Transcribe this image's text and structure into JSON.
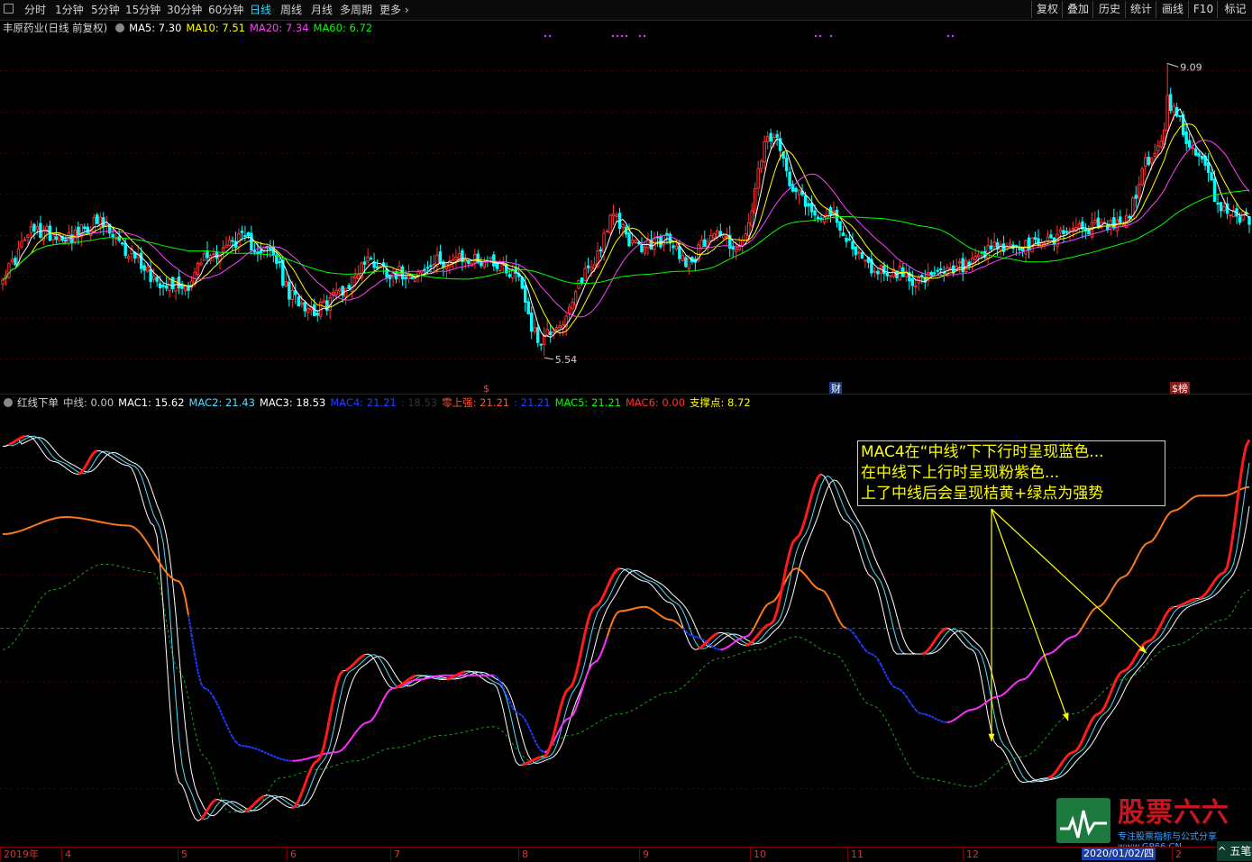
{
  "toolbar": {
    "tabs": [
      "分时",
      "1分钟",
      "5分钟",
      "15分钟",
      "30分钟",
      "60分钟",
      "日线",
      "周线",
      "月线",
      "多周期",
      "更多"
    ],
    "active_tab": "日线",
    "right_buttons": [
      "复权",
      "叠加",
      "历史",
      "统计",
      "画线",
      "F10",
      "标记"
    ]
  },
  "price_panel": {
    "stock_name": "丰原药业(日线 前复权)",
    "legend": [
      {
        "label": "MA5: 7.30",
        "color": "#ffffff"
      },
      {
        "label": "MA10: 7.51",
        "color": "#ffff00"
      },
      {
        "label": "MA20: 7.34",
        "color": "#ff40ff"
      },
      {
        "label": "MA60: 6.72",
        "color": "#00ff00"
      }
    ],
    "high_label": "9.09",
    "low_label": "5.54",
    "event_markers": [
      "$",
      "财",
      "$榜"
    ]
  },
  "indicator_panel": {
    "name": "红线下单",
    "legend": [
      {
        "label": "中线: 0.00",
        "color": "#c8c8c8"
      },
      {
        "label": "MAC1: 15.62",
        "color": "#ffffff"
      },
      {
        "label": "MAC2: 21.43",
        "color": "#50e0ff"
      },
      {
        "label": "MAC3: 18.53",
        "color": "#ffffff"
      },
      {
        "label": "MAC4: 21.21",
        "color": "#2040ff"
      },
      {
        "label": ": 18.53",
        "color": "#333333"
      },
      {
        "label": "零上强: 21.21",
        "color": "#ff5030"
      },
      {
        "label": ": 21.21",
        "color": "#2040ff"
      },
      {
        "label": "MAC5: 21.21",
        "color": "#00ff00"
      },
      {
        "label": "MAC6: 0.00",
        "color": "#ff3030"
      },
      {
        "label": "支撑点: 8.72",
        "color": "#ffff00"
      }
    ],
    "annotation_lines": [
      "MAC4在“中线”下下行时呈现蓝色...",
      "在中线下上行时呈现粉紫色...",
      "上了中线后会呈现桔黄+绿点为强势"
    ]
  },
  "x_axis_labels": [
    "2019年",
    "4",
    "5",
    "6",
    "7",
    "8",
    "9",
    "10",
    "11",
    "12",
    "2"
  ],
  "cursor_date": "2020/01/02/四",
  "watermark": {
    "title": "股票六六",
    "subtitle": "专注股票指标与公式分享",
    "site": "www.GP66.CN"
  },
  "bottom_button": "^ 五笔",
  "colors": {
    "up": "#ff3232",
    "down": "#00ffff",
    "ma5": "#ffffff",
    "ma10": "#ffff00",
    "ma20": "#ff40ff",
    "ma60": "#00ff00",
    "mac_blue": "#1e3cff",
    "mac_pink": "#ff30ff",
    "mac_orange": "#ff7a18",
    "mac_red": "#ff1a1a",
    "support": "#1aa01a"
  },
  "chart_data": [
    {
      "type": "candlestick",
      "title": "丰原药业(日线 前复权)",
      "series_keyframes": {
        "index": [
          0,
          10,
          22,
          30,
          40,
          50,
          58,
          65,
          75,
          85,
          92,
          100,
          108,
          116,
          124,
          132,
          140,
          148,
          155,
          163,
          170,
          178,
          186,
          194,
          202,
          210,
          218,
          226,
          234,
          244,
          252,
          258,
          262,
          268,
          276,
          284,
          292,
          300,
          308,
          316,
          324,
          332,
          340,
          348,
          356,
          364,
          372,
          380,
          388,
          396
        ],
        "close": [
          6.55,
          7.05,
          7.0,
          7.15,
          6.8,
          6.45,
          6.4,
          6.75,
          6.95,
          6.8,
          6.25,
          6.1,
          6.35,
          6.7,
          6.55,
          6.55,
          6.7,
          6.7,
          6.7,
          6.55,
          5.75,
          5.95,
          6.6,
          7.2,
          6.85,
          6.95,
          6.7,
          7.05,
          6.85,
          8.2,
          7.6,
          7.25,
          7.3,
          6.95,
          6.6,
          6.55,
          6.45,
          6.55,
          6.65,
          6.85,
          6.85,
          6.95,
          7.1,
          7.1,
          7.15,
          7.9,
          8.5,
          7.9,
          7.3,
          7.2
        ]
      },
      "high": 9.09,
      "low": 5.54,
      "ylim": [
        5.3,
        9.4
      ],
      "ma_series": [
        {
          "name": "MA5",
          "value": 7.3
        },
        {
          "name": "MA10",
          "value": 7.51
        },
        {
          "name": "MA20",
          "value": 7.34
        },
        {
          "name": "MA60",
          "value": 6.72
        }
      ]
    },
    {
      "type": "line",
      "title": "红线下单",
      "x_index_range": [
        0,
        396
      ],
      "series": [
        {
          "name": "MAC1",
          "x": [
            0,
            8,
            16,
            24,
            30,
            40,
            48,
            56,
            62,
            68,
            76,
            84,
            92,
            100,
            108,
            116,
            124,
            132,
            140,
            148,
            156,
            164,
            172,
            180,
            188,
            196,
            204,
            212,
            220,
            228,
            236,
            244,
            252,
            260,
            268,
            276,
            284,
            292,
            300,
            308,
            316,
            324,
            332,
            340,
            348,
            356,
            364,
            372,
            380,
            388,
            396
          ],
          "y": [
            85,
            90,
            78,
            72,
            83,
            76,
            48,
            -72,
            -90,
            -80,
            -86,
            -78,
            -84,
            -62,
            -20,
            -12,
            -28,
            -22,
            -24,
            -20,
            -26,
            -64,
            -60,
            -28,
            10,
            28,
            22,
            12,
            -10,
            -2,
            -8,
            2,
            42,
            72,
            50,
            24,
            -12,
            -12,
            0,
            -10,
            -55,
            -72,
            -70,
            -58,
            -40,
            -20,
            -6,
            10,
            14,
            26,
            88
          ]
        },
        {
          "name": "MAC4",
          "x": [
            0,
            20,
            40,
            56,
            64,
            76,
            92,
            106,
            116,
            124,
            132,
            140,
            148,
            156,
            164,
            172,
            180,
            188,
            196,
            204,
            212,
            220,
            228,
            236,
            244,
            252,
            260,
            268,
            276,
            284,
            292,
            300,
            308,
            316,
            324,
            332,
            340,
            348,
            356,
            364,
            372,
            380,
            388,
            396
          ],
          "y": [
            44,
            52,
            48,
            22,
            -28,
            -55,
            -62,
            -58,
            -44,
            -28,
            -24,
            -22,
            -22,
            -22,
            -40,
            -58,
            -42,
            -16,
            8,
            10,
            4,
            -4,
            -10,
            -4,
            12,
            28,
            18,
            0,
            -12,
            -28,
            -40,
            -44,
            -38,
            -32,
            -24,
            -12,
            -4,
            10,
            24,
            40,
            55,
            62,
            62,
            66
          ]
        },
        {
          "name": "MAC5",
          "x": [
            0,
            16,
            32,
            48,
            56,
            64,
            72,
            80,
            88,
            100,
            112,
            124,
            140,
            156,
            168,
            180,
            196,
            212,
            228,
            240,
            252,
            264,
            276,
            292,
            308,
            324,
            340,
            356,
            372,
            388,
            396
          ],
          "y": [
            -10,
            18,
            30,
            26,
            -20,
            -60,
            -86,
            -84,
            -70,
            -66,
            -62,
            -56,
            -50,
            -46,
            -62,
            -50,
            -40,
            -30,
            -14,
            -10,
            -4,
            -12,
            -36,
            -70,
            -74,
            -60,
            -40,
            -24,
            -8,
            4,
            18
          ]
        }
      ],
      "zero_line": 0
    }
  ]
}
